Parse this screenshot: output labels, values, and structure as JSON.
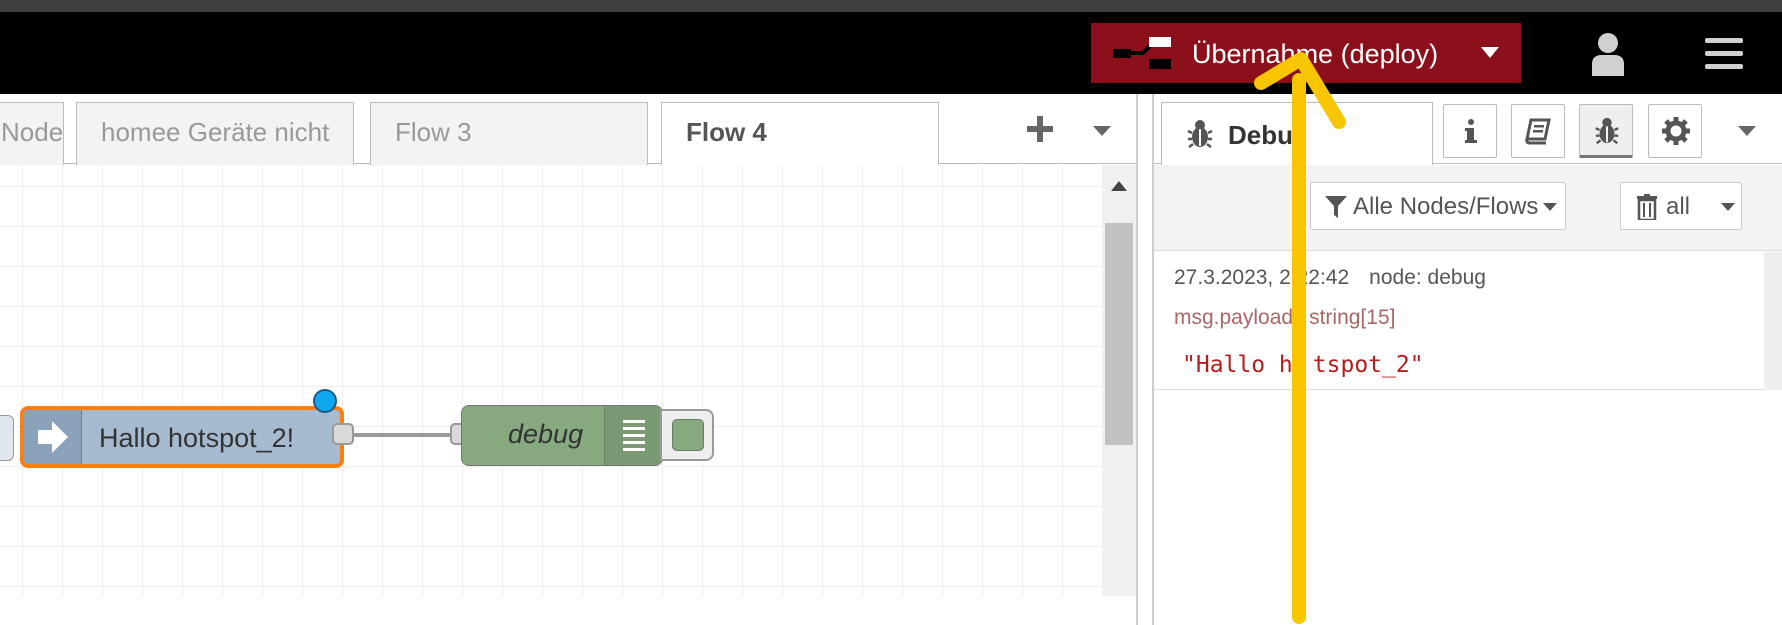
{
  "header": {
    "deploy_label": "Übernahme (deploy)",
    "icons": [
      "deploy-icon",
      "chevron-down-icon",
      "user-icon",
      "menu-icon"
    ]
  },
  "workspace": {
    "tabs": [
      {
        "label": "Node"
      },
      {
        "label": "homee Geräte nicht"
      },
      {
        "label": "Flow 3"
      },
      {
        "label": "Flow 4"
      }
    ],
    "active_tab": "Flow 4"
  },
  "flow": {
    "inject_node": {
      "label": "Hallo hotspot_2!",
      "color": "#a6bbcf",
      "selected_color": "#ff7f0e"
    },
    "debug_node": {
      "label": "debug",
      "color": "#87a980"
    }
  },
  "sidebar": {
    "active_tab_label": "Debu",
    "filter_label": "Alle Nodes/Flows",
    "clear_label": "all",
    "messages": [
      {
        "date": "27.3.2023, 2",
        "time": ":22:42",
        "node": "node: debug",
        "topic": "msg.payload",
        "type": "string[15]",
        "value": "\"Hallo h",
        "value_rest": "tspot_2\""
      }
    ]
  },
  "colors": {
    "header_bg": "#000000",
    "deploy_bg": "#8c101c",
    "annotation_arrow": "#f7c600"
  }
}
